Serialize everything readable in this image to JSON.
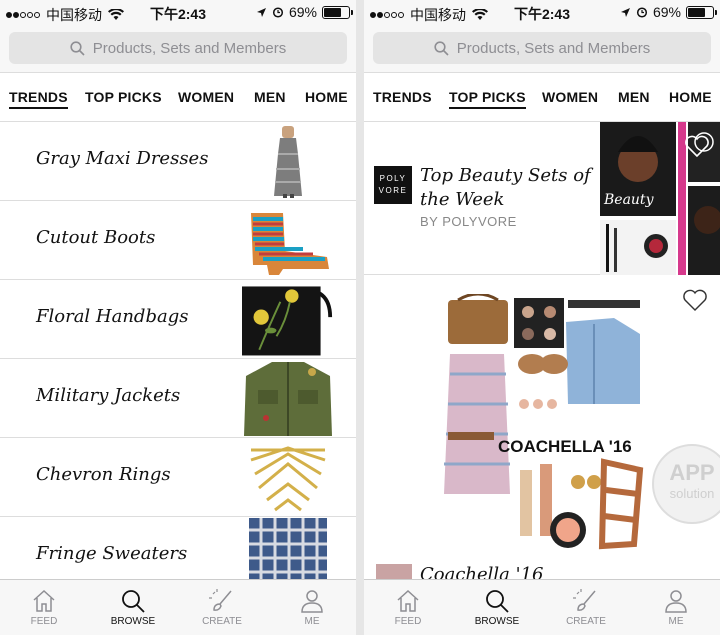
{
  "status": {
    "carrier": "中国移动",
    "time": "下午2:43",
    "battery": "69%",
    "battery_level": 0.69
  },
  "search": {
    "placeholder": "Products, Sets and Members"
  },
  "categories": [
    "TRENDS",
    "TOP PICKS",
    "WOMEN",
    "MEN",
    "HOME"
  ],
  "left": {
    "active_category": "TRENDS",
    "trends": [
      {
        "label": "Gray Maxi Dresses",
        "icon": "gray-maxi-dress-image"
      },
      {
        "label": "Cutout Boots",
        "icon": "cutout-boots-image"
      },
      {
        "label": "Floral Handbags",
        "icon": "floral-handbag-image"
      },
      {
        "label": "Military Jackets",
        "icon": "military-jacket-image"
      },
      {
        "label": "Chevron Rings",
        "icon": "chevron-ring-image"
      },
      {
        "label": "Fringe Sweaters",
        "icon": "fringe-sweater-image"
      }
    ]
  },
  "right": {
    "active_category": "TOP PICKS",
    "logo_text": [
      "POLY",
      "VORE"
    ],
    "card1": {
      "title": "Top Beauty Sets of the Week",
      "byline": "BY POLYVORE",
      "collage_text": "Beauty"
    },
    "card2": {
      "collage_text": "COACHELLA '16",
      "title": "Coachella '16"
    },
    "watermark": {
      "line1": "APP",
      "line2": "solution"
    }
  },
  "tabbar": [
    {
      "label": "FEED",
      "icon": "home-icon"
    },
    {
      "label": "BROWSE",
      "icon": "search-icon"
    },
    {
      "label": "CREATE",
      "icon": "brush-icon"
    },
    {
      "label": "ME",
      "icon": "person-icon"
    }
  ],
  "active_tab": "BROWSE",
  "colors": {
    "active": "#111111",
    "inactive": "#8e8e93",
    "search_bg": "#e4e4e4"
  }
}
